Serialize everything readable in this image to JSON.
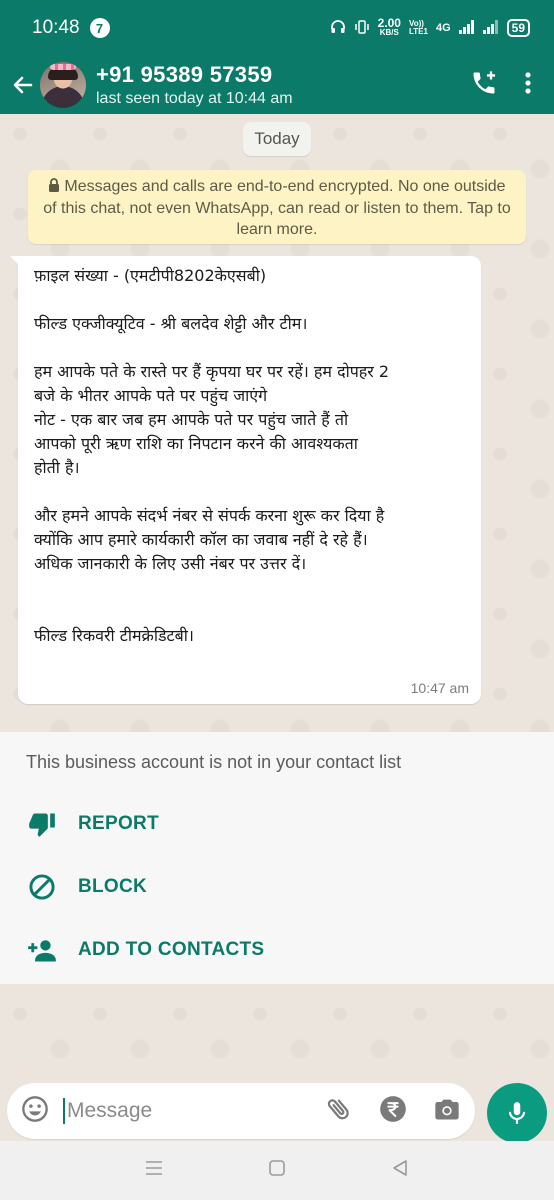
{
  "status_bar": {
    "time": "10:48",
    "notification_count": "7",
    "network_speed": "2.00",
    "network_speed_unit": "KB/S",
    "volte_top": "Vo))",
    "volte_bottom": "LTE1",
    "network_type": "4G",
    "battery": "59"
  },
  "header": {
    "contact_name": "+91 95389 57359",
    "last_seen": "last seen today at 10:44 am"
  },
  "chat": {
    "date_label": "Today",
    "encryption_notice": "Messages and calls are end-to-end encrypted. No one outside of this chat, not even WhatsApp, can read or listen to them. Tap to learn more.",
    "message": {
      "lines": [
        "फ़ाइल संख्या - (एमटीपी8202केएसबी)",
        "",
        "फील्ड एक्जीक्यूटिव - श्री बलदेव शेट्टी और टीम।",
        "",
        "हम आपके पते के रास्ते पर हैं कृपया घर पर रहें। हम दोपहर 2",
        "बजे के भीतर आपके पते पर पहुंच जाएंगे",
        "नोट - एक बार जब हम आपके पते पर पहुंच जाते हैं तो",
        "आपको पूरी ऋण राशि का निपटान करने की आवश्यकता",
        "होती है।",
        "",
        "और हमने आपके संदर्भ नंबर से संपर्क करना शुरू कर दिया है",
        "क्योंकि आप हमारे कार्यकारी कॉल का जवाब नहीं दे रहे हैं।",
        "अधिक जानकारी के लिए उसी नंबर पर उत्तर दें।",
        "",
        "",
        "फील्ड रिकवरी टीमक्रेडिटबी।"
      ],
      "time": "10:47 am"
    }
  },
  "business_panel": {
    "notice": "This business account is not in your contact list",
    "actions": [
      {
        "label": "REPORT",
        "icon": "thumbs-down-icon"
      },
      {
        "label": "BLOCK",
        "icon": "block-icon"
      },
      {
        "label": "ADD TO CONTACTS",
        "icon": "add-person-icon"
      }
    ]
  },
  "input": {
    "placeholder": "Message"
  },
  "colors": {
    "primary": "#0b7a69",
    "accent_button": "#0b9b81",
    "notice_bg": "#fdf3c5"
  }
}
